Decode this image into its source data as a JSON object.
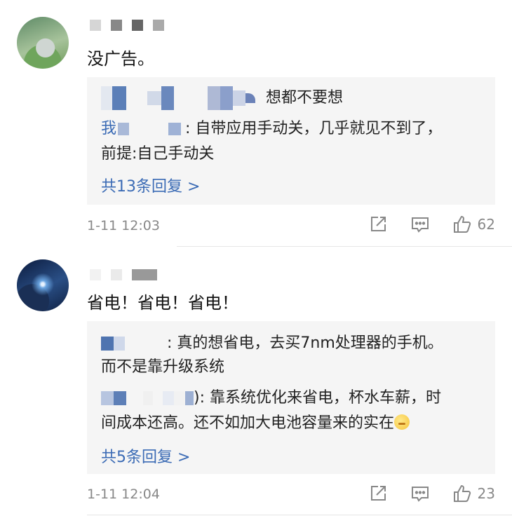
{
  "comments": [
    {
      "text": "没广告。",
      "replies": [
        {
          "suffix": "想都不要想"
        },
        {
          "prefix": "我",
          "text": ": 自带应用手动关，几乎就见不到了，"
        },
        {
          "text": "前提:自己手动关"
        }
      ],
      "more": "共13条回复 >",
      "time": "1-11 12:03",
      "likes": "62"
    },
    {
      "text": "省电！省电！省电！",
      "replies": [
        {
          "text": ": 真的想省电，去买7nm处理器的手机。"
        },
        {
          "text": "而不是靠升级系统"
        },
        {
          "text": "): 靠系统优化来省电，杯水车薪，时"
        },
        {
          "text": "间成本还高。还不如加大电池容量来的实在"
        }
      ],
      "more": "共5条回复 >",
      "time": "1-11 12:04",
      "likes": "23"
    }
  ],
  "icons": {
    "share": "share-icon",
    "comment": "comment-icon",
    "like": "thumbs-up-icon"
  },
  "colors": {
    "link": "#3b6bb5",
    "meta": "#888888",
    "reply_bg": "#f5f5f5"
  }
}
